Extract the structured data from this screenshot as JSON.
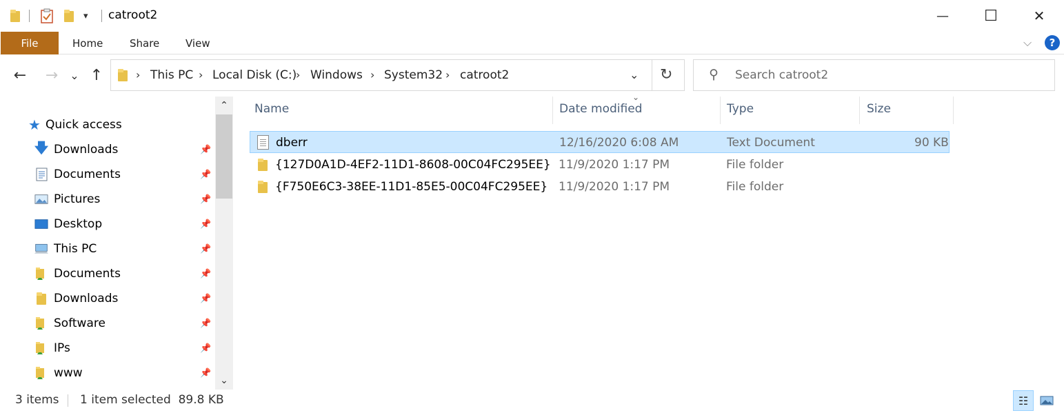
{
  "window": {
    "title": "catroot2",
    "minimize_glyph": "—",
    "maximize_glyph": "☐",
    "close_glyph": "✕"
  },
  "quick_access_toolbar": {
    "dropdown_glyph": "▾",
    "properties_icon": "properties-checkmark-icon"
  },
  "ribbon": {
    "tabs": [
      "File",
      "Home",
      "Share",
      "View"
    ],
    "collapse_glyph": "⌵",
    "help_glyph": "?",
    "file_tab_color": "#b36b19"
  },
  "navigation": {
    "back_glyph": "←",
    "forward_glyph": "→",
    "recent_glyph": "⌄",
    "up_glyph": "↑"
  },
  "address_bar": {
    "crumbs": [
      "This PC",
      "Local Disk (C:)",
      "Windows",
      "System32",
      "catroot2"
    ],
    "separator_glyph": "›",
    "dropdown_glyph": "⌄",
    "refresh_glyph": "↻"
  },
  "search": {
    "placeholder": "Search catroot2",
    "icon": "search-icon",
    "glyph": "⚲"
  },
  "nav_pane": {
    "quick_access_label": "Quick access",
    "pin_glyph": "📌",
    "items": [
      {
        "label": "Downloads",
        "icon": "download-arrow-icon"
      },
      {
        "label": "Documents",
        "icon": "documents-icon"
      },
      {
        "label": "Pictures",
        "icon": "pictures-icon"
      },
      {
        "label": "Desktop",
        "icon": "desktop-icon"
      },
      {
        "label": "This PC",
        "icon": "computer-icon"
      },
      {
        "label": "Documents",
        "icon": "shared-folder-icon"
      },
      {
        "label": "Downloads",
        "icon": "folder-icon"
      },
      {
        "label": "Software",
        "icon": "shared-folder-icon"
      },
      {
        "label": "IPs",
        "icon": "shared-folder-icon"
      },
      {
        "label": "www",
        "icon": "shared-folder-icon"
      }
    ],
    "scroll_up_glyph": "⌃",
    "scroll_down_glyph": "⌄"
  },
  "file_list": {
    "columns": {
      "name": "Name",
      "date": "Date modified",
      "type": "Type",
      "size": "Size"
    },
    "sort_glyph": "⌄",
    "rows": [
      {
        "name": "dberr",
        "date": "12/16/2020 6:08 AM",
        "type": "Text Document",
        "size": "90 KB",
        "icon": "text-document-icon",
        "selected": true
      },
      {
        "name": "{127D0A1D-4EF2-11D1-8608-00C04FC295EE}",
        "date": "11/9/2020 1:17 PM",
        "type": "File folder",
        "size": "",
        "icon": "folder-icon",
        "selected": false
      },
      {
        "name": "{F750E6C3-38EE-11D1-85E5-00C04FC295EE}",
        "date": "11/9/2020 1:17 PM",
        "type": "File folder",
        "size": "",
        "icon": "folder-icon",
        "selected": false
      }
    ],
    "selection_color": "#cce8ff"
  },
  "status_bar": {
    "item_count": "3 items",
    "selection": "1 item selected  89.8 KB",
    "details_view_glyph": "☷",
    "thumbnail_view_glyph": "▭"
  }
}
